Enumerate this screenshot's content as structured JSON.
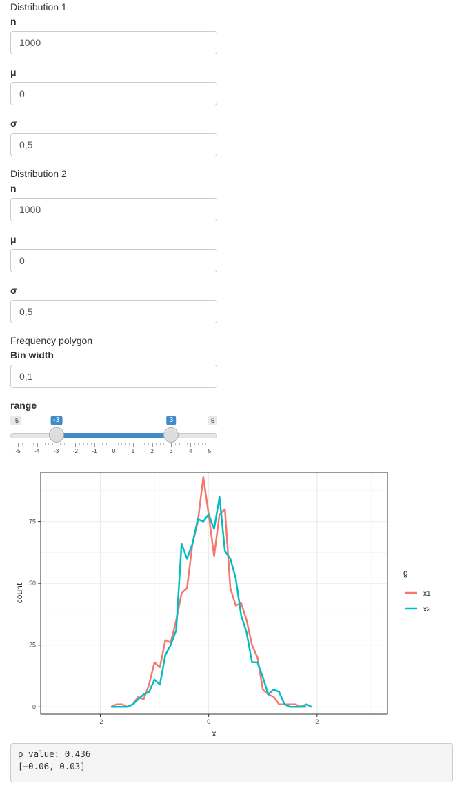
{
  "dist1": {
    "title": "Distribution 1",
    "n_label": "n",
    "n_value": "1000",
    "mu_label": "μ",
    "mu_value": "0",
    "sigma_label": "σ",
    "sigma_value": "0,5"
  },
  "dist2": {
    "title": "Distribution 2",
    "n_label": "n",
    "n_value": "1000",
    "mu_label": "μ",
    "mu_value": "0",
    "sigma_label": "σ",
    "sigma_value": "0,5"
  },
  "polygon": {
    "title": "Frequency polygon",
    "bin_label": "Bin width",
    "bin_value": "0,1"
  },
  "range": {
    "label": "range",
    "min": -5,
    "max": 5,
    "min_label": "-5",
    "max_label": "5",
    "from": -3,
    "to": 3,
    "from_label": "-3",
    "to_label": "3",
    "ticks": [
      "-5",
      "-4",
      "-3",
      "-2",
      "-1",
      "0",
      "1",
      "2",
      "3",
      "4",
      "5"
    ],
    "accent": "#428bca"
  },
  "output": {
    "p_value": "p value: 0.436",
    "interval": "[−0.06, 0.03]"
  },
  "chart_data": {
    "type": "line",
    "xlabel": "x",
    "ylabel": "count",
    "xlim": [
      -3.1,
      3.3
    ],
    "ylim": [
      -3,
      95
    ],
    "x_ticks": [
      -2,
      0,
      2
    ],
    "x_tick_labels": [
      "-2",
      "0",
      "2"
    ],
    "y_ticks": [
      0,
      25,
      50,
      75
    ],
    "y_tick_labels": [
      "0",
      "25",
      "50",
      "75"
    ],
    "grid": true,
    "legend_title": "g",
    "legend_position": "right",
    "series": [
      {
        "name": "x1",
        "color": "#f8766d",
        "x": [
          -1.8,
          -1.7,
          -1.6,
          -1.5,
          -1.4,
          -1.3,
          -1.2,
          -1.1,
          -1.0,
          -0.9,
          -0.8,
          -0.7,
          -0.6,
          -0.5,
          -0.4,
          -0.3,
          -0.2,
          -0.1,
          0.0,
          0.1,
          0.2,
          0.3,
          0.4,
          0.5,
          0.6,
          0.7,
          0.8,
          0.9,
          1.0,
          1.1,
          1.2,
          1.3,
          1.4,
          1.5,
          1.6,
          1.7,
          1.8
        ],
        "values": [
          0,
          1,
          1,
          0,
          1,
          4,
          3,
          9,
          18,
          16,
          27,
          26,
          35,
          46,
          48,
          66,
          75,
          93,
          78,
          61,
          78,
          80,
          48,
          41,
          42,
          35,
          25,
          20,
          7,
          5,
          4,
          1,
          1,
          1,
          1,
          0,
          0
        ]
      },
      {
        "name": "x2",
        "color": "#00bfc4",
        "x": [
          -1.8,
          -1.7,
          -1.6,
          -1.5,
          -1.4,
          -1.3,
          -1.2,
          -1.1,
          -1.0,
          -0.9,
          -0.8,
          -0.7,
          -0.6,
          -0.5,
          -0.4,
          -0.3,
          -0.2,
          -0.1,
          0.0,
          0.1,
          0.2,
          0.3,
          0.4,
          0.5,
          0.6,
          0.7,
          0.8,
          0.9,
          1.0,
          1.1,
          1.2,
          1.3,
          1.4,
          1.5,
          1.6,
          1.7,
          1.8,
          1.9
        ],
        "values": [
          0,
          0,
          0,
          0,
          1,
          3,
          5,
          6,
          11,
          9,
          21,
          25,
          31,
          66,
          60,
          66,
          76,
          75,
          78,
          72,
          85,
          63,
          60,
          52,
          37,
          30,
          18,
          18,
          12,
          5,
          7,
          6,
          1,
          0,
          0,
          0,
          1,
          0
        ]
      }
    ]
  }
}
